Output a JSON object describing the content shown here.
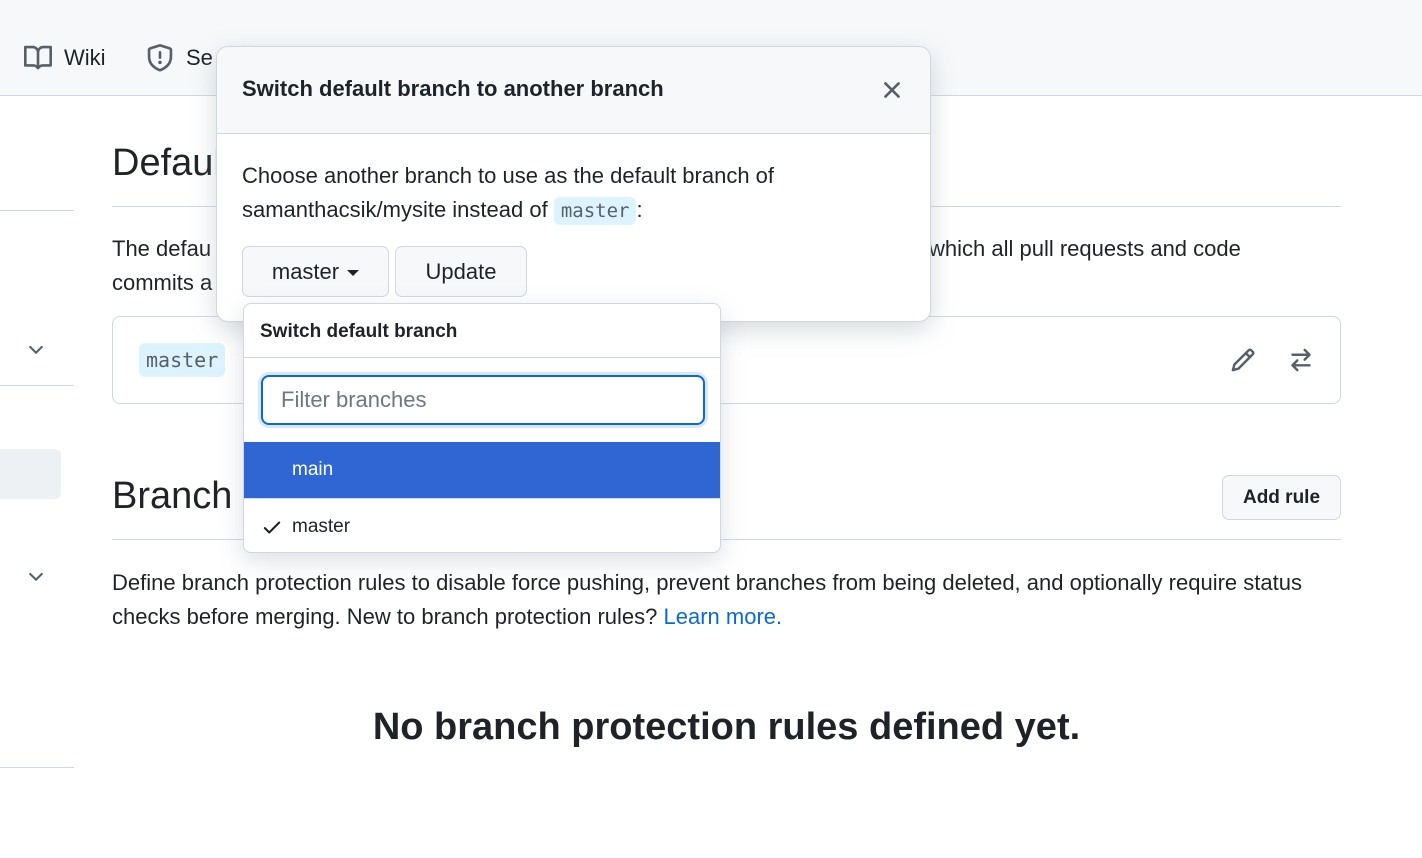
{
  "nav": {
    "wiki_label": "Wiki",
    "security_label": "Se"
  },
  "default_branch_section": {
    "heading": "Defaul",
    "description_line1_left": "The defau",
    "description_line1_right": "which all pull requests and code",
    "description_line2_left": "commits a",
    "current_branch": "master"
  },
  "branch_protection_section": {
    "heading": "Branch",
    "add_rule_label": "Add rule",
    "description": "Define branch protection rules to disable force pushing, prevent branches from being deleted, and optionally require status checks before merging. New to branch protection rules? ",
    "learn_more_label": "Learn more.",
    "empty_title": "No branch protection rules defined yet."
  },
  "modal": {
    "title": "Switch default branch to another branch",
    "body_prefix": "Choose another branch to use as the default branch of samanthacsik/mysite instead of ",
    "body_code": "master",
    "body_suffix": ":",
    "branch_button_label": "master",
    "update_label": "Update"
  },
  "dropdown": {
    "title": "Switch default branch",
    "filter_placeholder": "Filter branches",
    "filter_value": "",
    "items": [
      {
        "label": "main",
        "highlighted": true,
        "checked": false
      },
      {
        "label": "master",
        "highlighted": false,
        "checked": true
      }
    ]
  },
  "colors": {
    "accent": "#0969da",
    "highlight": "#2f66d4",
    "code_bg": "#ddf4ff",
    "border": "#d0d7de"
  }
}
